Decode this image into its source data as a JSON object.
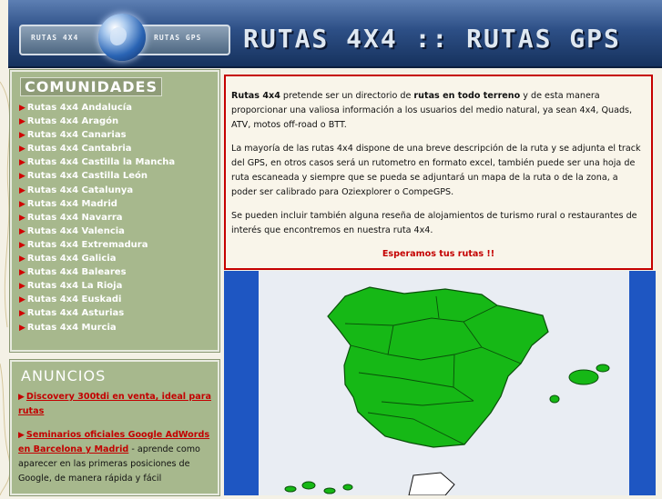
{
  "header": {
    "logo_left": "RUTAS 4X4",
    "logo_right": "RUTAS GPS",
    "title": "RUTAS 4X4 :: RUTAS GPS"
  },
  "sidebar": {
    "communities_title": "COMUNIDADES",
    "communities": [
      "Rutas 4x4 Andalucía",
      "Rutas 4x4 Aragón",
      "Rutas 4x4 Canarias",
      "Rutas 4x4 Cantabria",
      "Rutas 4x4 Castilla la Mancha",
      "Rutas 4x4 Castilla León",
      "Rutas 4x4 Catalunya",
      "Rutas 4x4 Madrid",
      "Rutas 4x4 Navarra",
      "Rutas 4x4 Valencia",
      "Rutas 4x4 Extremadura",
      "Rutas 4x4 Galicia",
      "Rutas 4x4 Baleares",
      "Rutas 4x4 La Rioja",
      "Rutas 4x4 Euskadi",
      "Rutas 4x4 Asturias",
      "Rutas 4x4 Murcia"
    ],
    "ads_title": "ANUNCIOS",
    "ads": [
      {
        "link": "Discovery 300tdi en venta, ideal para rutas",
        "text": ""
      },
      {
        "link": "Seminarios oficiales Google AdWords en Barcelona y Madrid",
        "text": " - aprende como aparecer en las primeras posiciones de Google, de manera rápida y fácil"
      }
    ]
  },
  "content": {
    "p1_bold1": "Rutas 4x4",
    "p1_t1": " pretende ser un directorio de ",
    "p1_bold2": "rutas en todo terreno",
    "p1_t2": " y de esta manera proporcionar una valiosa información a los usuarios del medio natural, ya sean 4x4, Quads, ATV, motos off-road o BTT.",
    "p2": "La mayoría de las rutas 4x4 dispone de una breve descripción de la ruta y se adjunta el track del GPS, en otros casos será un rutometro en formato excel, también puede ser una hoja de ruta escaneada y siempre que se pueda se adjuntará un mapa de la ruta o de la zona, a poder ser calibrado para Oziexplorer o CompeGPS.",
    "p3": "Se pueden incluir también alguna reseña de alojamientos de turismo rural o restaurantes de interés que encontremos en nuestra ruta 4x4.",
    "cta": "Esperamos tus rutas !!"
  },
  "colors": {
    "map_green": "#16b816",
    "sea_blue": "#1e56c2",
    "panel_border": "#c50000",
    "sidebar_bg": "#a7b88d"
  }
}
